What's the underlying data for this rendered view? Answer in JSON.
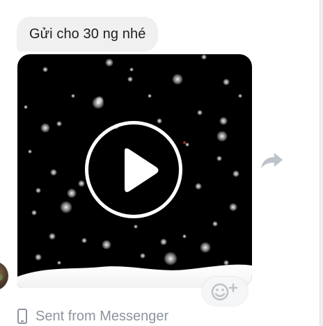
{
  "message": {
    "text": "Gửi cho 30 ng nhé"
  },
  "video": {
    "icon": "play-icon"
  },
  "actions": {
    "share_icon": "share-icon",
    "reaction_icon": "add-reaction-icon"
  },
  "footer": {
    "icon": "phone-icon",
    "text": "Sent from Messenger"
  },
  "colors": {
    "bubble": "#f1f0f0",
    "muted": "#8d949e",
    "video_bg": "#000000"
  }
}
